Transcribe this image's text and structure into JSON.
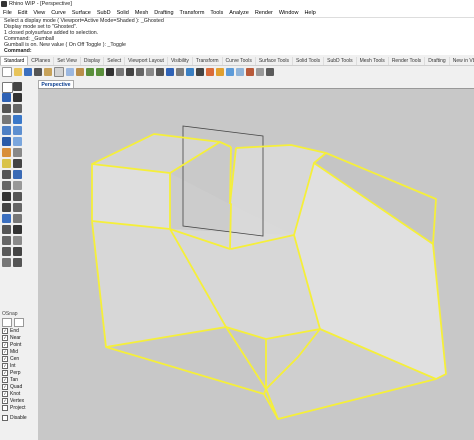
{
  "window": {
    "title": "Rhino WIP - [Perspective]"
  },
  "menu": [
    "File",
    "Edit",
    "View",
    "Curve",
    "Surface",
    "SubD",
    "Solid",
    "Mesh",
    "Drafting",
    "Transform",
    "Tools",
    "Analyze",
    "Render",
    "Window",
    "Help"
  ],
  "command_history": [
    "Select a display mode ( Viewport=Active  Mode=Shaded ): _Ghosted",
    "Display mode set to \"Ghosted\".",
    "1 closed polysurface added to selection.",
    "Command: _Gumball",
    "Gumball is on. New value ( On  Off  Toggle ): _Toggle"
  ],
  "command_prompt": "Command:",
  "tabs": [
    "Standard",
    "CPlanes",
    "Set View",
    "Display",
    "Select",
    "Viewport Layout",
    "Visibility",
    "Transform",
    "Curve Tools",
    "Surface Tools",
    "Solid Tools",
    "SubD Tools",
    "Mesh Tools",
    "Render Tools",
    "Drafting",
    "New in V8"
  ],
  "active_tab": "Standard",
  "viewport": {
    "label": "Perspective",
    "background": "#c8c8c8",
    "selection_color": "#f5ef3a"
  },
  "osnap": {
    "title": "OSnap",
    "items": [
      {
        "label": "End",
        "checked": true
      },
      {
        "label": "Near",
        "checked": true
      },
      {
        "label": "Point",
        "checked": true
      },
      {
        "label": "Mid",
        "checked": true
      },
      {
        "label": "Cen",
        "checked": true
      },
      {
        "label": "Int",
        "checked": true
      },
      {
        "label": "Perp",
        "checked": true
      },
      {
        "label": "Tan",
        "checked": true
      },
      {
        "label": "Quad",
        "checked": true
      },
      {
        "label": "Knot",
        "checked": true
      },
      {
        "label": "Vertex",
        "checked": true
      },
      {
        "label": "Project",
        "checked": false
      }
    ],
    "disable_label": "Disable"
  }
}
